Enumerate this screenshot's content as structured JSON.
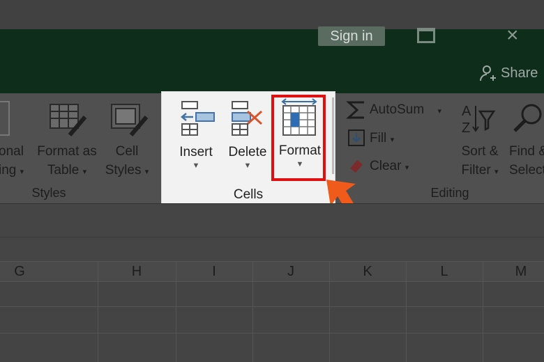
{
  "titlebar": {
    "sign_in": "Sign in",
    "share": "Share"
  },
  "ribbon": {
    "styles_group": {
      "conditional_partial_top": "onal",
      "conditional_partial_bottom": "ing",
      "format_as_table_top": "Format as",
      "format_as_table_bottom": "Table",
      "cell_styles_top": "Cell",
      "cell_styles_bottom": "Styles",
      "label": "Styles"
    },
    "cells_group": {
      "insert": "Insert",
      "delete": "Delete",
      "format": "Format",
      "label": "Cells"
    },
    "editing_group": {
      "autosum": "AutoSum",
      "fill": "Fill",
      "clear": "Clear",
      "sort_filter_top": "Sort &",
      "sort_filter_bottom": "Filter",
      "find_select_top": "Find &",
      "find_select_bottom": "Select",
      "label": "Editing"
    }
  },
  "columns": [
    "G",
    "H",
    "I",
    "J",
    "K",
    "L",
    "M"
  ],
  "colors": {
    "highlight": "#e01010",
    "arrow": "#f05a1a",
    "title_green": "#0e2d1b"
  },
  "icons": [
    "share-icon",
    "sigma-icon",
    "fill-icon",
    "eraser-icon",
    "sort-filter-icon",
    "magnifier-icon",
    "insert-cells-icon",
    "delete-cells-icon",
    "format-cells-icon",
    "table-format-icon",
    "cell-styles-icon",
    "pointer-arrow-icon"
  ]
}
